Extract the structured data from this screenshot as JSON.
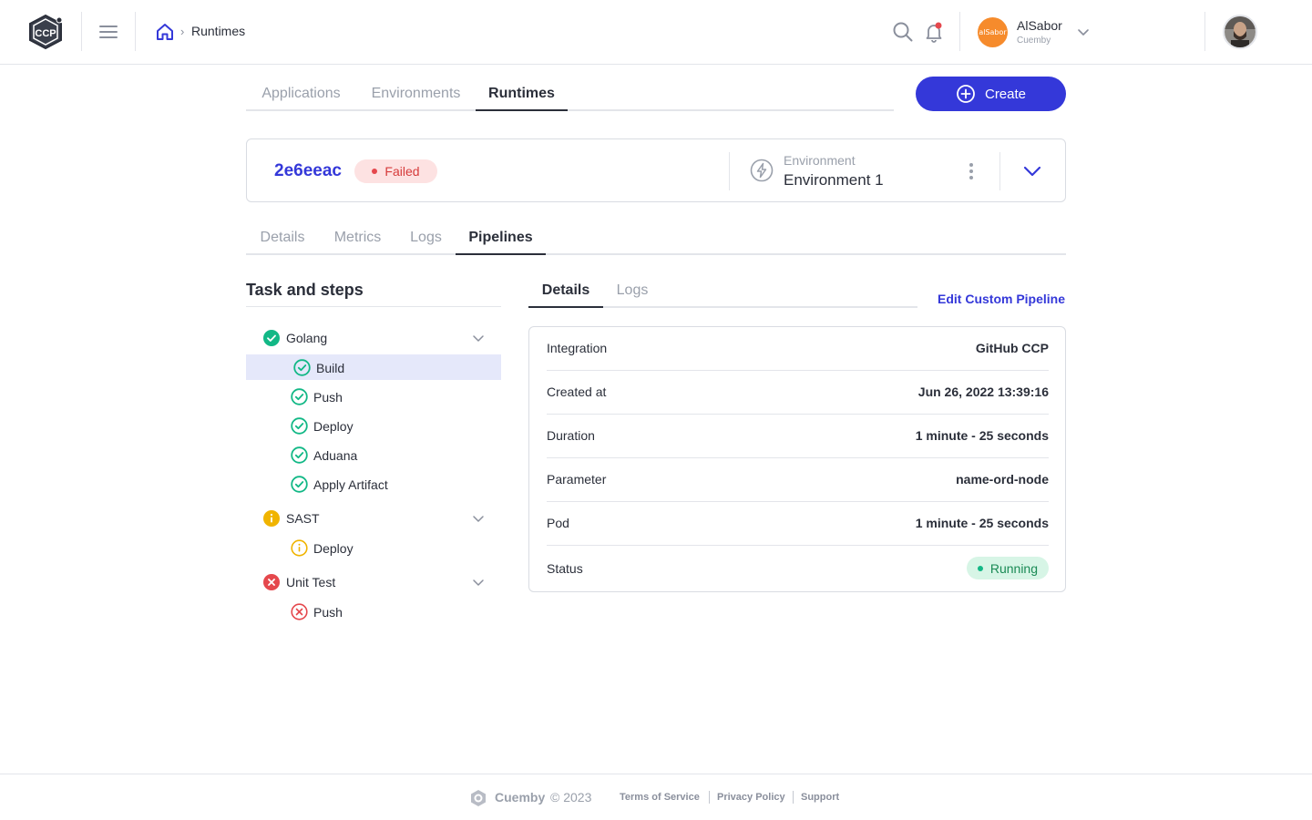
{
  "header": {
    "logo_text": "CCP",
    "breadcrumb": {
      "current": "Runtimes"
    },
    "org": {
      "name": "AlSabor",
      "subtitle": "Cuemby",
      "avatar_text": "alSabor"
    }
  },
  "main_tabs": [
    {
      "label": "Applications",
      "active": false
    },
    {
      "label": "Environments",
      "active": false
    },
    {
      "label": "Runtimes",
      "active": true
    }
  ],
  "create_button": {
    "label": "Create"
  },
  "runtime": {
    "id": "2e6eeac",
    "status": "Failed",
    "environment_label": "Environment",
    "environment_value": "Environment 1"
  },
  "sub_tabs": [
    {
      "label": "Details",
      "active": false
    },
    {
      "label": "Metrics",
      "active": false
    },
    {
      "label": "Logs",
      "active": false
    },
    {
      "label": "Pipelines",
      "active": true
    }
  ],
  "tasks": {
    "title": "Task and steps",
    "groups": [
      {
        "name": "Golang",
        "state": "success",
        "steps": [
          {
            "name": "Build",
            "state": "success",
            "selected": true
          },
          {
            "name": "Push",
            "state": "success"
          },
          {
            "name": "Deploy",
            "state": "success"
          },
          {
            "name": "Aduana",
            "state": "success"
          },
          {
            "name": "Apply Artifact",
            "state": "success"
          }
        ]
      },
      {
        "name": "SAST",
        "state": "warning",
        "steps": [
          {
            "name": "Deploy",
            "state": "warning"
          }
        ]
      },
      {
        "name": "Unit Test",
        "state": "error",
        "steps": [
          {
            "name": "Push",
            "state": "error"
          }
        ]
      }
    ]
  },
  "detail_tabs": [
    {
      "label": "Details",
      "active": true
    },
    {
      "label": "Logs",
      "active": false
    }
  ],
  "edit_link": "Edit Custom Pipeline",
  "details": {
    "integration": {
      "label": "Integration",
      "value": "GitHub CCP"
    },
    "created_at": {
      "label": "Created at",
      "value": "Jun 26, 2022 13:39:16"
    },
    "duration": {
      "label": "Duration",
      "value": "1 minute - 25 seconds"
    },
    "parameter": {
      "label": "Parameter",
      "value": "name-ord-node"
    },
    "pod": {
      "label": "Pod",
      "value": "1 minute - 25 seconds"
    },
    "status": {
      "label": "Status",
      "value": "Running"
    }
  },
  "footer": {
    "brand": "Cuemby",
    "copyright": "© 2023",
    "links": [
      "Terms of Service",
      "Privacy Policy",
      "Support"
    ]
  },
  "colors": {
    "accent": "#3438d9",
    "success": "#12b886",
    "warning": "#f0b400",
    "error": "#e5484d",
    "failed_bg": "#fde2e2",
    "running_bg": "#d7f5e6"
  }
}
